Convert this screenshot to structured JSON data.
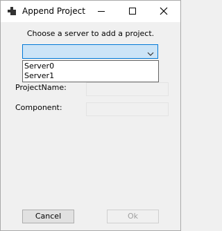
{
  "window": {
    "title": "Append Project"
  },
  "titlebar": {
    "icon": "app-window-icon",
    "controls": [
      "minimize-icon",
      "maximize-icon",
      "close-icon"
    ]
  },
  "form": {
    "prompt": "Choose a server to add a project.",
    "server_combo": {
      "value": "",
      "options": [
        "Server0",
        "Server1"
      ]
    },
    "project_name_label": "ProjectName:",
    "project_name_value": "",
    "component_label": "Component:",
    "component_value": ""
  },
  "buttons": {
    "cancel": "Cancel",
    "ok": "Ok"
  },
  "colors": {
    "combo_bg": "#cce4f7",
    "combo_border": "#0078d7",
    "disabled_text": "#a0a0a0"
  }
}
